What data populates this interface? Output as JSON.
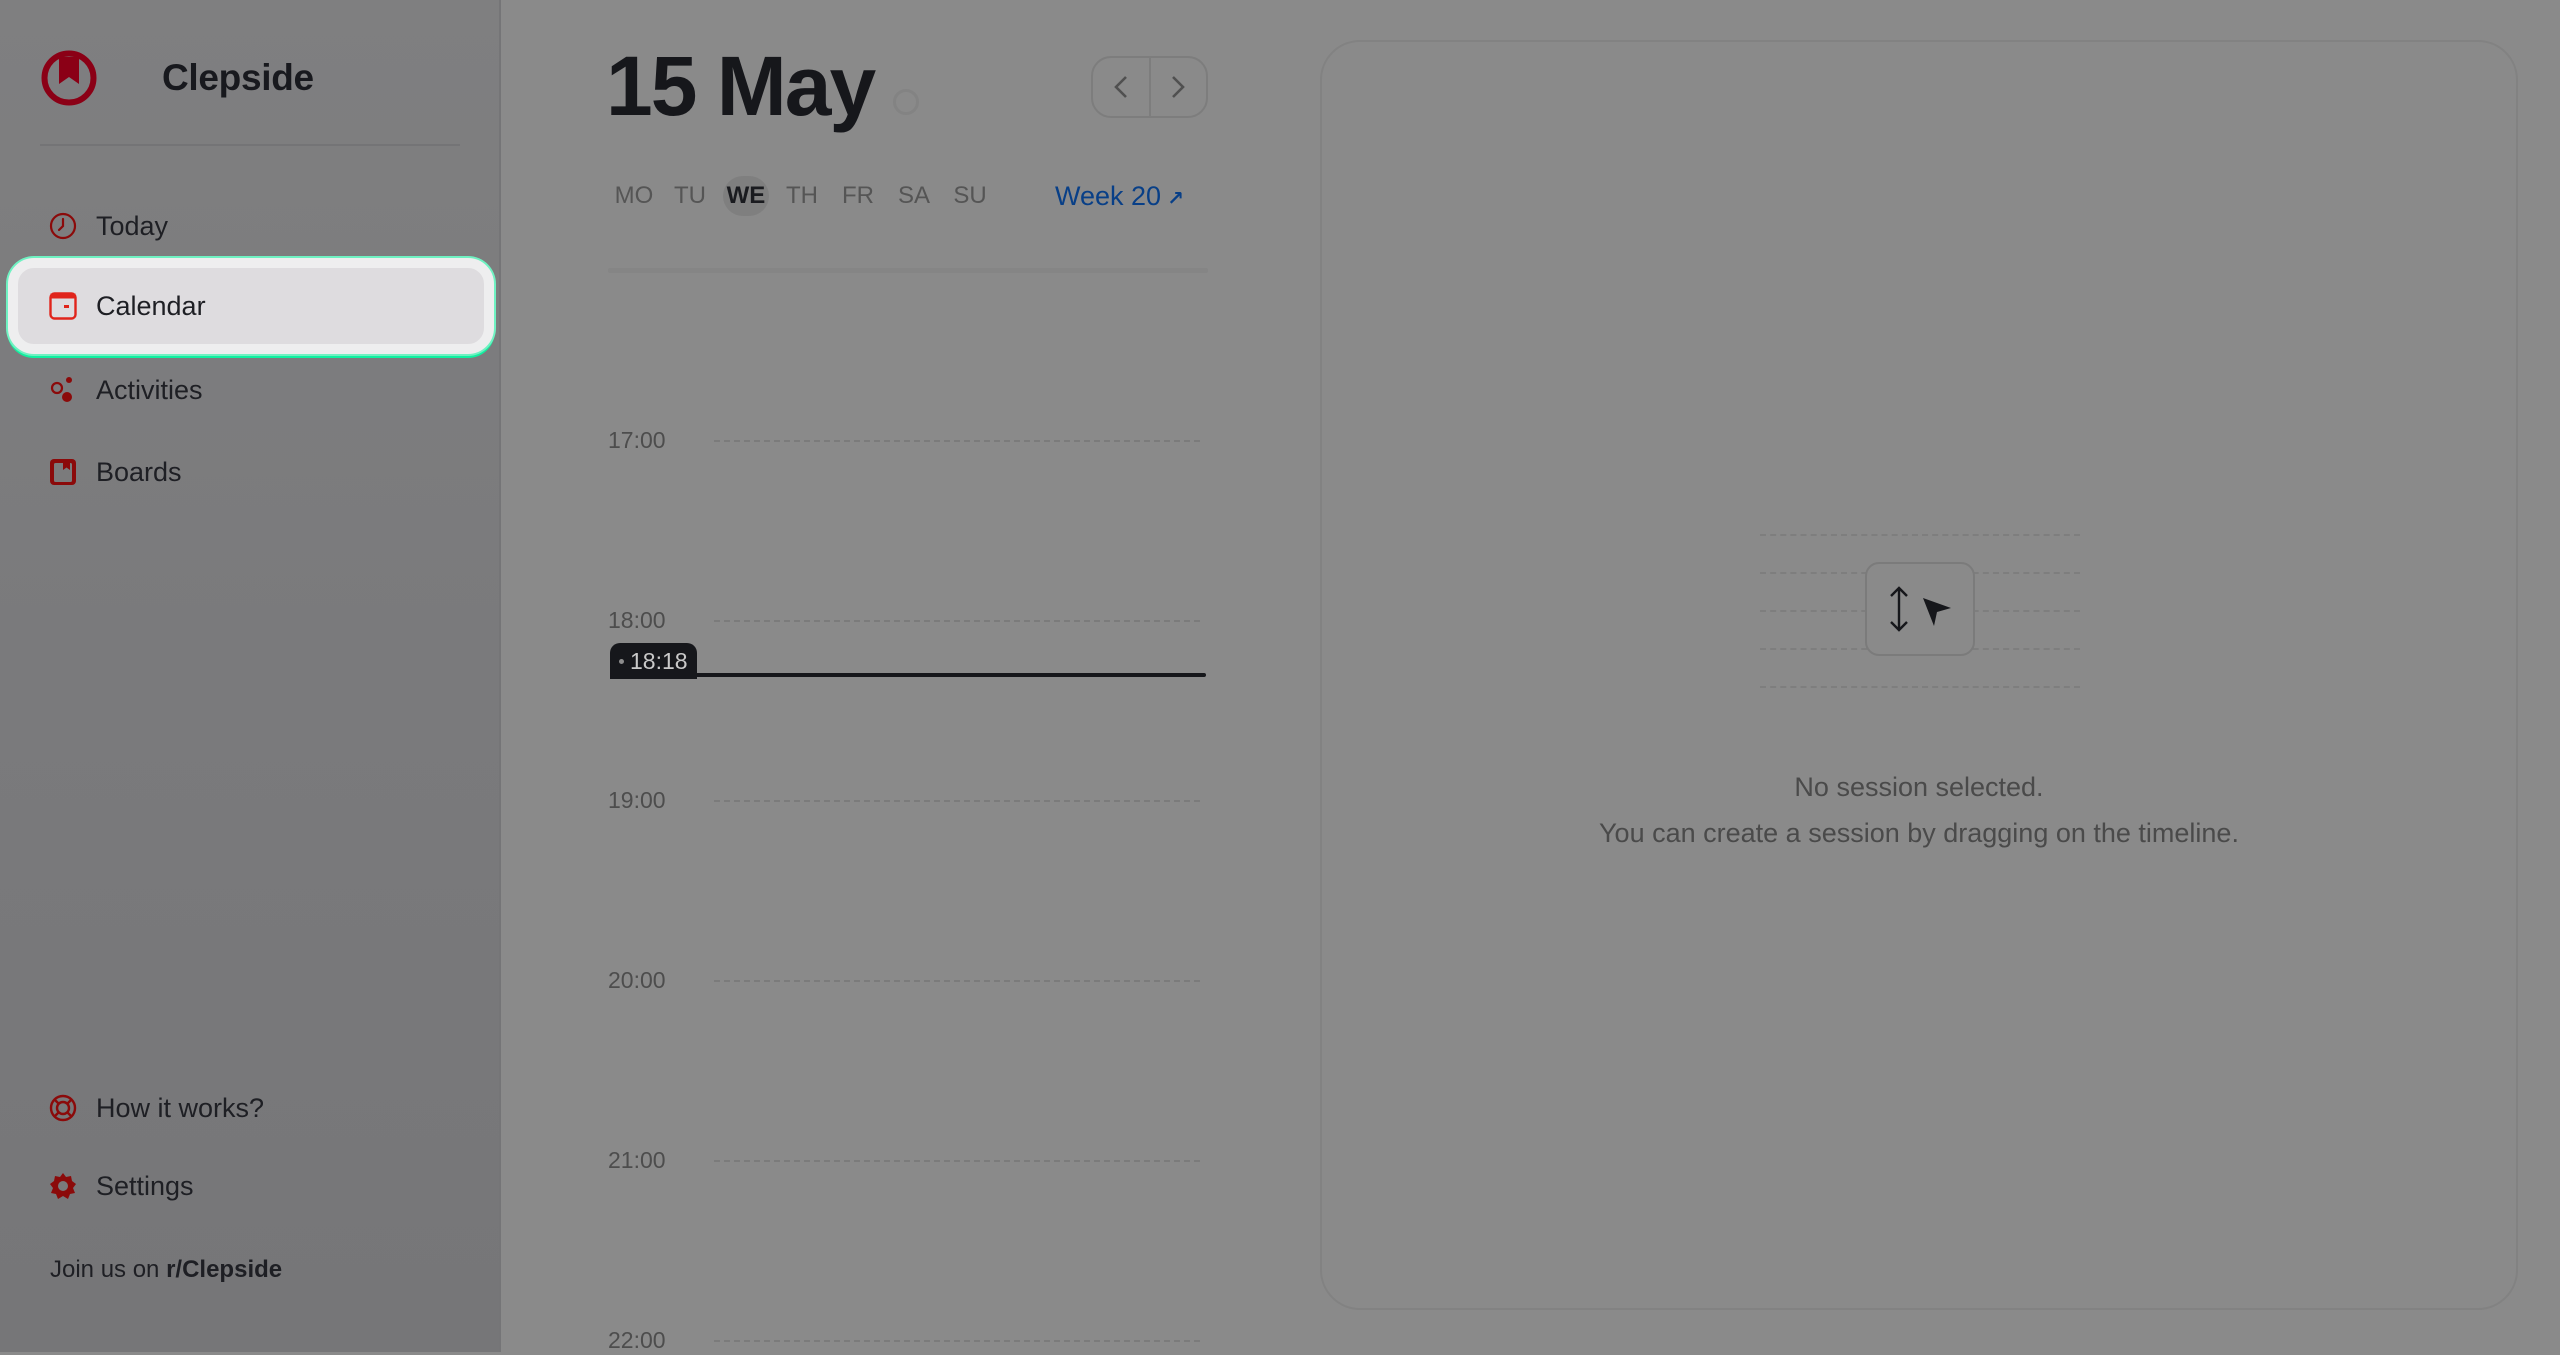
{
  "app": {
    "name": "Clepside"
  },
  "sidebar": {
    "items": [
      {
        "label": "Today",
        "icon": "clock-icon"
      },
      {
        "label": "Calendar",
        "icon": "calendar-icon",
        "active": true
      },
      {
        "label": "Activities",
        "icon": "activities-icon"
      },
      {
        "label": "Boards",
        "icon": "board-icon"
      }
    ],
    "footer_items": [
      {
        "label": "How it works?",
        "icon": "lifebuoy-icon"
      },
      {
        "label": "Settings",
        "icon": "gear-icon"
      }
    ],
    "join": {
      "prefix": "Join us on",
      "link": "r/Clepside"
    }
  },
  "header": {
    "title": "15 May",
    "prev_label": "‹",
    "next_label": "›",
    "weekdays": [
      "MO",
      "TU",
      "WE",
      "TH",
      "FR",
      "SA",
      "SU"
    ],
    "current_weekday": "WE",
    "week_link": "Week 20",
    "week_link_arrow": "↗"
  },
  "timeline": {
    "hours": [
      "17:00",
      "18:00",
      "19:00",
      "20:00",
      "21:00",
      "22:00"
    ],
    "now": "18:18"
  },
  "detail": {
    "empty_title": "No session selected.",
    "empty_subtitle": "You can create a session by dragging on the timeline."
  },
  "colors": {
    "brand": "#8b0016",
    "accent_red": "#e0241b",
    "link": "#083f87",
    "highlight_ring": "#10f0a0"
  }
}
